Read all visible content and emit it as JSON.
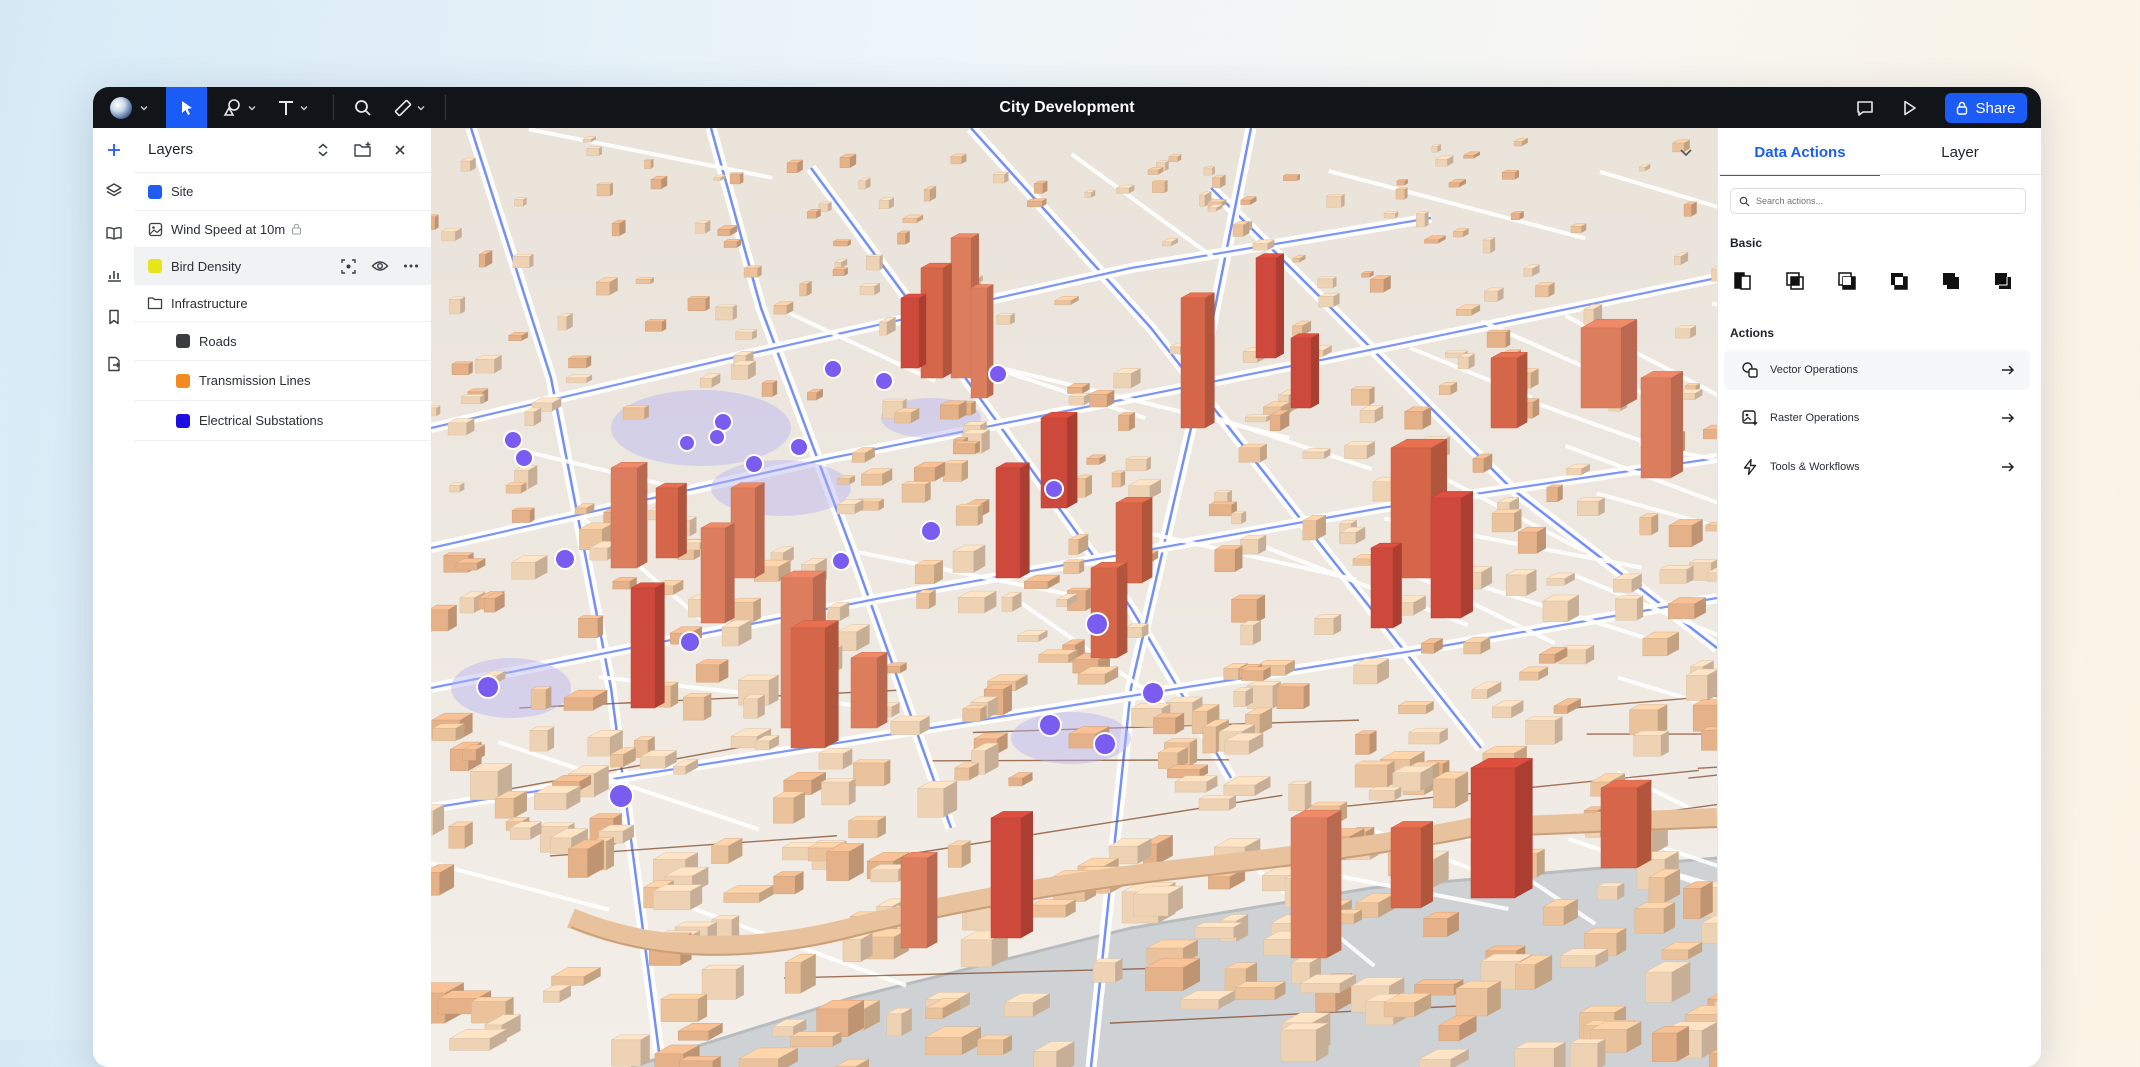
{
  "window": {
    "title": "City Development"
  },
  "toolbar": {
    "tools": [
      "globe-icon",
      "select-arrow-icon",
      "shapes-icon",
      "text-icon",
      "search-icon",
      "measure-icon"
    ],
    "active_tool": "select-arrow-icon",
    "share_label": "Share",
    "right_icons": [
      "comment-icon",
      "play-icon",
      "lock-icon"
    ]
  },
  "rail": {
    "icons": [
      "plus-icon",
      "layers-icon",
      "book-icon",
      "chart-icon",
      "bookmark-icon",
      "file-export-icon"
    ]
  },
  "layers": {
    "title": "Layers",
    "items": [
      {
        "label": "Site",
        "color": "#1f5cf2",
        "type": "swatch"
      },
      {
        "label": "Wind Speed at 10m",
        "type": "raster",
        "locked": true
      },
      {
        "label": "Bird Density",
        "color": "#e9e51c",
        "type": "swatch",
        "selected": true
      },
      {
        "label": "Infrastructure",
        "type": "folder"
      },
      {
        "label": "Roads",
        "color": "#3b3c3f",
        "type": "swatch",
        "indent": true
      },
      {
        "label": "Transmission Lines",
        "color": "#f28b1f",
        "type": "swatch",
        "indent": true
      },
      {
        "label": "Electrical Substations",
        "color": "#1c0fe0",
        "type": "swatch",
        "indent": true
      }
    ]
  },
  "panel": {
    "tabs": [
      "Data Actions",
      "Layer"
    ],
    "active_tab": "Data Actions",
    "search_placeholder": "Search actions...",
    "basic_label": "Basic",
    "basic_icons": [
      "split-icon",
      "intersect-icon",
      "union-icon",
      "difference-icon",
      "exclude-icon",
      "merge-icon"
    ],
    "actions_label": "Actions",
    "actions": [
      {
        "label": "Vector Operations",
        "icon": "vector-ops-icon"
      },
      {
        "label": "Raster Operations",
        "icon": "raster-ops-icon"
      },
      {
        "label": "Tools & Workflows",
        "icon": "bolt-icon"
      }
    ]
  },
  "colors": {
    "accent": "#1a5cf5",
    "topbar": "#111418",
    "building_light": "#efc7a0",
    "building_tall": "#d04a3c",
    "substation": "#7b5cf0",
    "road": "#5b7cf5"
  }
}
